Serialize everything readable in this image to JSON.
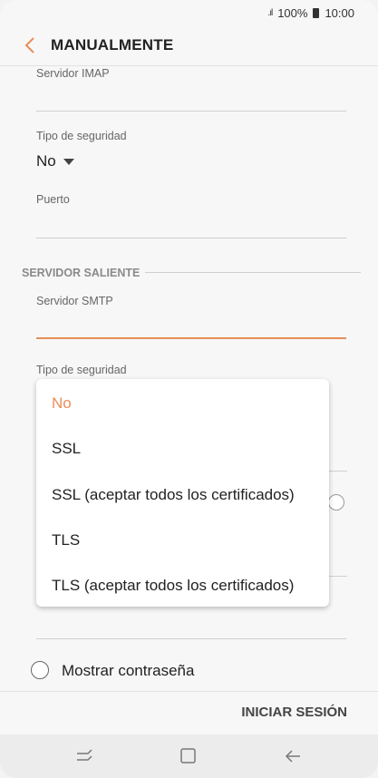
{
  "status": {
    "signal": ".ıl",
    "battery": "100%",
    "time": "10:00"
  },
  "header": {
    "title": "MANUALMENTE"
  },
  "incoming": {
    "imap_label": "Servidor IMAP",
    "security_label": "Tipo de seguridad",
    "security_value": "No",
    "port_label": "Puerto"
  },
  "outgoing": {
    "section_title": "SERVIDOR SALIENTE",
    "smtp_label": "Servidor SMTP",
    "security_label": "Tipo de seguridad"
  },
  "dropdown": {
    "options": [
      "No",
      "SSL",
      "SSL (aceptar todos los certificados)",
      "TLS",
      "TLS (aceptar todos los certificados)"
    ],
    "selected": "No"
  },
  "show_password_label": "Mostrar contraseña",
  "actions": {
    "login": "INICIAR SESIÓN"
  },
  "colors": {
    "accent": "#e88d5a"
  }
}
